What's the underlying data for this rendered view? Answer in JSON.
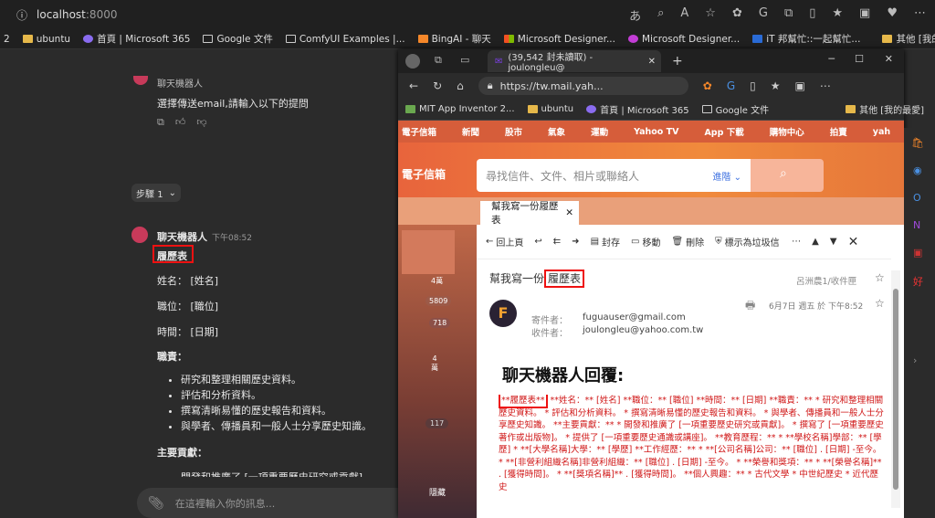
{
  "top": {
    "host": "localhost",
    "port": ":8000"
  },
  "bookmarks": [
    "2",
    "ubuntu",
    "首頁 | Microsoft 365",
    "Google 文件",
    "ComfyUI Examples |...",
    "BingAI - 聊天",
    "Microsoft Designer...",
    "Microsoft Designer...",
    "iT 邦幫忙::一起幫忙...",
    "其他 [我的最愛]"
  ],
  "chat": {
    "prev_bot": "聊天機器人",
    "prev_msg": "選擇傳送email,請輸入以下的提問",
    "step": "步驟 1",
    "bot_name": "聊天機器人",
    "time": "下午08:52",
    "heading": "履歷表",
    "name": "姓名： [姓名]",
    "position": "職位： [職位]",
    "time_field": "時間： [日期]",
    "duties": "職責：",
    "bullets": [
      "研究和整理相關歷史資料。",
      "評估和分析資料。",
      "撰寫清晰易懂的歷史報告和資料。",
      "與學者、傳播員和一般人士分享歷史知識。"
    ],
    "contrib": "主要貢獻：",
    "cut": "開發和推廣了 [一項重要歷史研究或貢獻]",
    "placeholder": "在這裡輸入你的訊息..."
  },
  "front": {
    "tab": "(39,542 封未讀取) - joulongleu@",
    "url": "https://tw.mail.yah...",
    "bookmarks": [
      "MIT App Inventor 2...",
      "ubuntu",
      "首頁 | Microsoft 365",
      "Google 文件",
      "其他 [我的最愛]"
    ],
    "ynav": [
      "電子信箱",
      "新聞",
      "股市",
      "氣象",
      "運動",
      "Yahoo TV",
      "App 下載",
      "購物中心",
      "拍賣",
      "yah"
    ],
    "brand": "電子信箱",
    "search_ph": "尋找信件、文件、相片或聯絡人",
    "adv": "進階",
    "tab_title": "幫我寫一份履歷表",
    "toolbar": {
      "back": "回上頁",
      "archive": "封存",
      "move": "移動",
      "delete": "刪除",
      "spam": "標示為垃圾信"
    },
    "subject_pre": "幫我寫一份",
    "subject_box": "履歷表",
    "folder": "呂洲農1/收件匣",
    "date": "6月7日 週五 於 下午8:52",
    "from_label": "寄件者：",
    "from": "fuguauser@gmail.com",
    "to_label": "收件者：",
    "to": "joulongleu@yahoo.com.tw",
    "mail_title": "聊天機器人回覆:",
    "body_box": "**履歷表**",
    "body": " **姓名：** [姓名] **職位：** [職位] **時間：** [日期] **職責：** * 研究和整理相關歷史資料。 * 評估和分析資料。 * 撰寫清晰易懂的歷史報告和資料。 * 與學者、傳播員和一般人士分享歷史知識。 **主要貢獻：** * 開發和推廣了 [一項重要歷史研究或貢獻]。 * 撰寫了 [一項重要歷史著作或出版物]。 * 提供了 [一項重要歷史通識或講座]。 **教育歷程：** * **學校名稱]學部：** [學歷] * **[大學名稱]大學：** [學歷] **工作經歷：** * **[公司名稱]公司：** [職位] . [日期] -至今。 * **[非營利組織名稱]非營利組織：** [職位] . [日期] -至今。 * **榮譽和獎項：** * **[榮譽名稱]** . [獲得時間]。 * **[獎項名稱]** . [獲得時間]。 **個人興趣：** * 古代文學 * 中世紀歷史 * 近代歷史",
    "left_counts": [
      "4萬",
      "5809",
      "718",
      "4\n萬",
      "117"
    ],
    "hide": "隱藏"
  }
}
